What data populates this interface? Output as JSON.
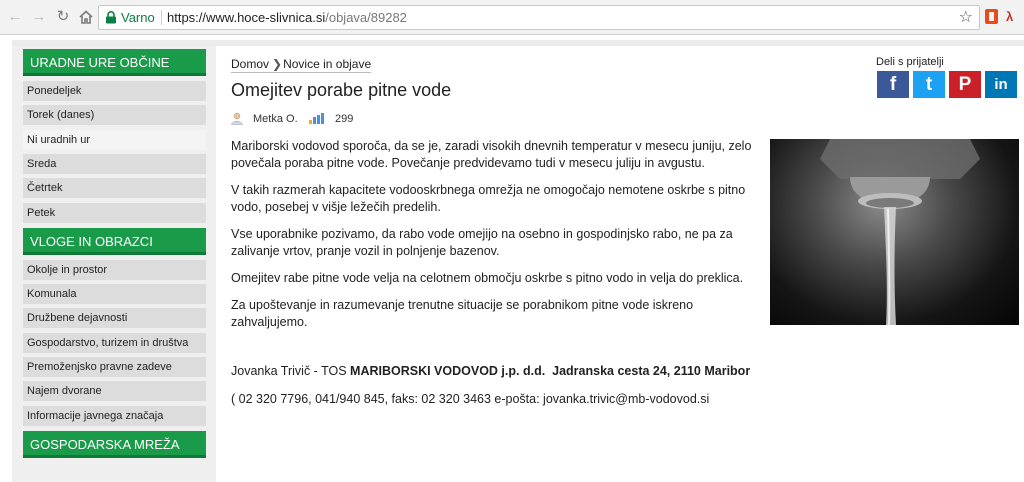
{
  "browser": {
    "secure_label": "Varno",
    "url_host": "https://www.hoce-slivnica.si",
    "url_path": "/objava/89282"
  },
  "sidebar": {
    "sections": [
      {
        "title": "URADNE URE OBČINE",
        "items": [
          {
            "label": "Ponedeljek"
          },
          {
            "label": "Torek (danes)"
          },
          {
            "label": "Ni uradnih ur",
            "active": true
          },
          {
            "label": "Sreda"
          },
          {
            "label": "Četrtek"
          },
          {
            "label": "Petek"
          }
        ]
      },
      {
        "title": "VLOGE IN OBRAZCI",
        "items": [
          {
            "label": "Okolje in prostor"
          },
          {
            "label": "Komunala"
          },
          {
            "label": "Družbene dejavnosti"
          },
          {
            "label": "Gospodarstvo, turizem in društva"
          },
          {
            "label": "Premoženjsko pravne zadeve"
          },
          {
            "label": "Najem dvorane"
          },
          {
            "label": "Informacije javnega značaja"
          }
        ]
      },
      {
        "title": "GOSPODARSKA MREŽA",
        "items": []
      }
    ]
  },
  "breadcrumb": {
    "home": "Domov",
    "current": "Novice in objave"
  },
  "article": {
    "title": "Omejitev porabe pitne vode",
    "author": "Metka O.",
    "views": "299",
    "paragraphs": [
      "Mariborski vodovod sporoča, da se je, zaradi visokih dnevnih temperatur v mesecu juniju, zelo povečala poraba pitne vode. Povečanje predvidevamo tudi v mesecu juliju in avgustu.",
      "V takih razmerah kapacitete vodooskrbnega omrežja ne omogočajo nemotene oskrbe s pitno vodo, posebej v višje ležečih predelih.",
      "Vse uporabnike pozivamo, da rabo vode omejijo na osebno in gospodinjsko rabo, ne pa za zalivanje vrtov, pranje vozil in polnjenje bazenov.",
      "Omejitev rabe pitne vode velja na celotnem območju oskrbe s pitno vodo in velja do preklica.",
      "Za upoštevanje in razumevanje trenutne situacije se porabnikom pitne vode iskreno zahvaljujemo."
    ],
    "signature_name": "Jovanka Trivič - TOS",
    "signature_company": "MARIBORSKI VODOVOD j.p. d.d.",
    "signature_address": "Jadranska cesta 24, 2110 Maribor",
    "contact": "( 02 320 7796, 041/940 845, faks:  02 320 3463  e-pošta: jovanka.trivic@mb-vodovod.si"
  },
  "share": {
    "label": "Deli s prijatelji",
    "buttons": [
      {
        "name": "facebook",
        "glyph": "f",
        "color": "#3b5998"
      },
      {
        "name": "twitter",
        "glyph": "t",
        "color": "#1da1f2"
      },
      {
        "name": "pinterest",
        "glyph": "P",
        "color": "#cb2027"
      },
      {
        "name": "linkedin",
        "glyph": "in",
        "color": "#0077b5"
      }
    ]
  }
}
